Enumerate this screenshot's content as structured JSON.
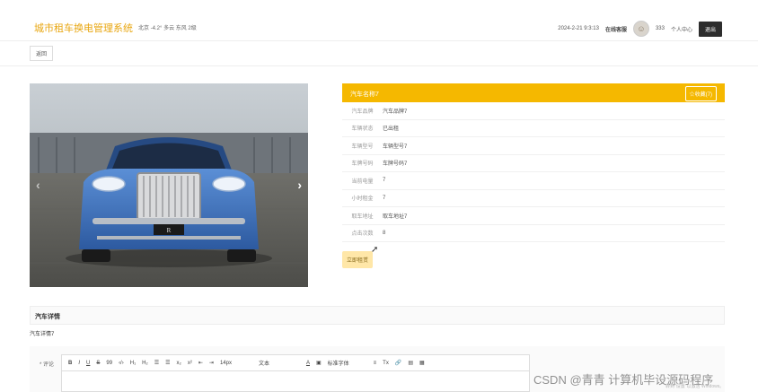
{
  "header": {
    "brand": "城市租车换电管理系统",
    "weather": "北京  -4.2°  多云  东风  2级",
    "datetime": "2024-2-21 9:3:13",
    "online_label": "在线客服",
    "username": "333",
    "profile_label": "个人中心",
    "logout_label": "退出"
  },
  "nav": {
    "back_label": "返回"
  },
  "carousel": {
    "prev_icon": "‹",
    "next_icon": "›"
  },
  "info": {
    "title": "汽车名称7",
    "favorite_label": "☆收藏(7)",
    "rows": [
      {
        "key": "汽车品牌",
        "value": "汽车品牌7"
      },
      {
        "key": "车辆状态",
        "value": "已出租"
      },
      {
        "key": "车辆型号",
        "value": "车辆型号7"
      },
      {
        "key": "车牌号码",
        "value": "车牌号码7"
      },
      {
        "key": "当前电量",
        "value": "7"
      },
      {
        "key": "小时租金",
        "value": "7"
      },
      {
        "key": "取车地址",
        "value": "取车地址7"
      },
      {
        "key": "点击次数",
        "value": "8"
      }
    ],
    "rent_label": "立即租赁"
  },
  "detail": {
    "title": "汽车详情",
    "text": "汽车详情7"
  },
  "comment": {
    "label": "* 评论",
    "toolbar": [
      "B",
      "I",
      "U",
      "S",
      "99",
      "‹/›",
      "H₁",
      "H₂",
      "☰",
      "☰",
      "x₂",
      "x²",
      "⇤",
      "⇥",
      "14px",
      "文本",
      "A",
      "▣",
      "标准字体",
      "≡",
      "Tx",
      "🔗",
      "▤",
      "▦"
    ]
  },
  "watermark": {
    "text": "CSDN @青青    计算机毕设源码程序",
    "sub": "转到\"设置\"以激活 Windows。"
  },
  "colors": {
    "accent": "#f5b800",
    "brand": "#e8a60f",
    "car_body": "#3e6fb8"
  }
}
